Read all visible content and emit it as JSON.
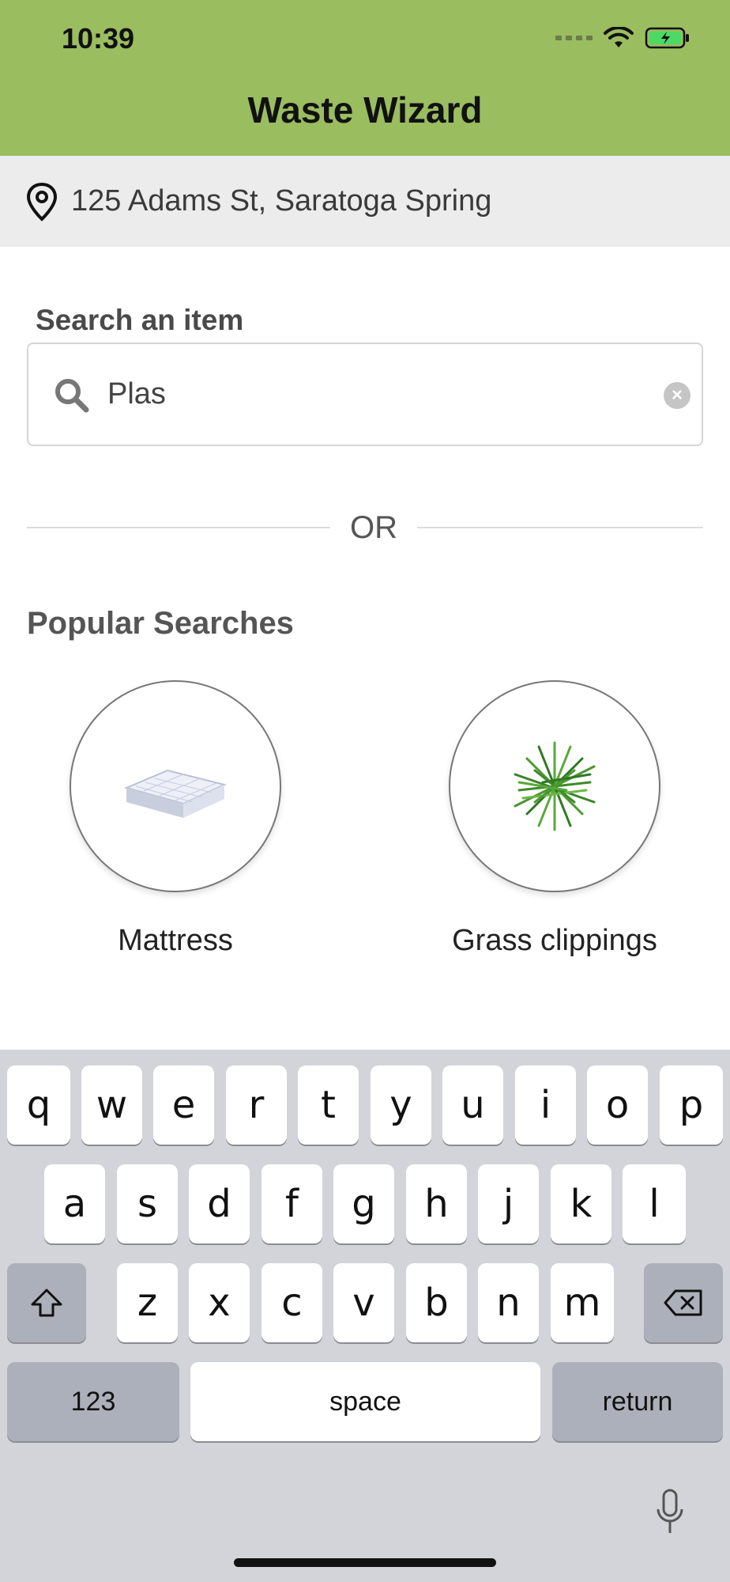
{
  "status_bar": {
    "time": "10:39"
  },
  "header": {
    "title": "Waste Wizard"
  },
  "address": {
    "text": "125 Adams St, Saratoga Spring"
  },
  "search": {
    "label": "Search an item",
    "value": "Plas"
  },
  "divider": {
    "text": "OR"
  },
  "popular": {
    "title": "Popular Searches",
    "items": [
      {
        "label": "Mattress",
        "icon": "mattress-image"
      },
      {
        "label": "Grass clippings",
        "icon": "grass-image"
      }
    ]
  },
  "keyboard": {
    "row1": [
      "q",
      "w",
      "e",
      "r",
      "t",
      "y",
      "u",
      "i",
      "o",
      "p"
    ],
    "row2": [
      "a",
      "s",
      "d",
      "f",
      "g",
      "h",
      "j",
      "k",
      "l"
    ],
    "row3": [
      "z",
      "x",
      "c",
      "v",
      "b",
      "n",
      "m"
    ],
    "numbers_label": "123",
    "space_label": "space",
    "return_label": "return"
  },
  "colors": {
    "header_bg": "#9abd60",
    "address_bg": "#ececec",
    "keyboard_bg": "#d2d4da"
  }
}
